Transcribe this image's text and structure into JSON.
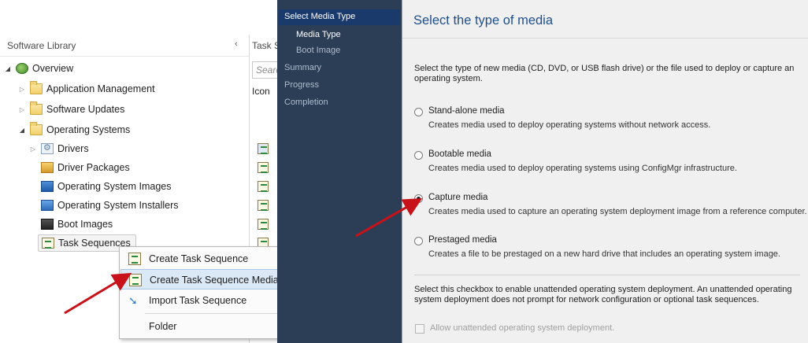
{
  "console": {
    "panel_title": "Software Library",
    "collapse_glyph": "‹",
    "tree": [
      {
        "label": "Overview",
        "icon": "overview-icon",
        "expanded": true
      },
      {
        "label": "Application Management",
        "icon": "folder-icon",
        "expanded": false
      },
      {
        "label": "Software Updates",
        "icon": "folder-icon",
        "expanded": false
      },
      {
        "label": "Operating Systems",
        "icon": "folder-icon",
        "expanded": true
      },
      {
        "label": "Drivers",
        "icon": "drivers-icon",
        "expanded": false
      },
      {
        "label": "Driver Packages",
        "icon": "driver-package-icon"
      },
      {
        "label": "Operating System Images",
        "icon": "os-image-icon"
      },
      {
        "label": "Operating System Installers",
        "icon": "os-installer-icon"
      },
      {
        "label": "Boot Images",
        "icon": "boot-image-icon"
      },
      {
        "label": "Task Sequences",
        "icon": "task-sequence-icon",
        "selected": true
      }
    ],
    "list": {
      "title": "Task S",
      "search_placeholder": "Searc",
      "column_icon": "Icon"
    }
  },
  "context_menu": {
    "items": [
      {
        "label": "Create Task Sequence",
        "icon": "task-sequence-icon"
      },
      {
        "label": "Create Task Sequence Media",
        "icon": "task-sequence-media-icon",
        "highlighted": true
      },
      {
        "label": "Import Task Sequence",
        "icon": "import-icon"
      },
      {
        "label": "Folder"
      }
    ]
  },
  "wizard": {
    "nav": {
      "active": "Select Media Type",
      "media_type": "Media Type",
      "boot_image": "Boot Image",
      "summary": "Summary",
      "progress": "Progress",
      "completion": "Completion"
    },
    "heading": "Select the type of media",
    "intro": "Select the type of new media (CD, DVD, or USB flash drive) or the file used to deploy or capture an operating system.",
    "options": [
      {
        "label": "Stand-alone media",
        "desc": "Creates media used to deploy operating systems without network access.",
        "selected": false
      },
      {
        "label": "Bootable media",
        "desc": "Creates media used to deploy operating systems using ConfigMgr infrastructure.",
        "selected": false
      },
      {
        "label": "Capture media",
        "desc": "Creates media used to capture an operating system deployment image from a reference computer.",
        "selected": true
      },
      {
        "label": "Prestaged media",
        "desc": "Creates a file to be prestaged on a new hard drive that includes an operating system image.",
        "selected": false
      }
    ],
    "unattended_text": "Select this checkbox to enable unattended operating system deployment. An unattended operating system deployment does not prompt for network configuration or optional task sequences.",
    "unattended_checkbox": "Allow unattended operating system deployment.",
    "unattended_checked": false
  },
  "colors": {
    "wizard_nav_bg": "#2c3e55",
    "wizard_nav_active": "#1a3a6c",
    "heading": "#1f4f8b",
    "arrow": "#c8121a",
    "menu_highlight": "#dbe8f6"
  }
}
